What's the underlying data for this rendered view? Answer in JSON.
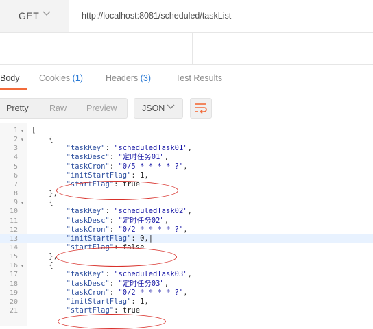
{
  "request": {
    "method": "GET",
    "url": "http://localhost:8081/scheduled/taskList"
  },
  "tabs": [
    {
      "label": "Body",
      "count": null,
      "active": true
    },
    {
      "label": "Cookies",
      "count": "(1)",
      "active": false
    },
    {
      "label": "Headers",
      "count": "(3)",
      "active": false
    },
    {
      "label": "Test Results",
      "count": null,
      "active": false
    }
  ],
  "toolbar": {
    "pretty": "Pretty",
    "raw": "Raw",
    "preview": "Preview",
    "format": "JSON"
  },
  "colors": {
    "accent": "#f26b3a",
    "count_blue": "#2a7ad5",
    "highlight_line": "#e8f2ff",
    "annotation_red": "#d8302a"
  },
  "highlighted_line": 13,
  "code_lines": [
    {
      "n": "1",
      "fold": true,
      "text": "["
    },
    {
      "n": "2",
      "fold": true,
      "text": "    {"
    },
    {
      "n": "3",
      "fold": false,
      "key": "taskKey",
      "value": "\"scheduledTask01\"",
      "comma": true
    },
    {
      "n": "4",
      "fold": false,
      "key": "taskDesc",
      "value": "\"定时任务01\"",
      "comma": true
    },
    {
      "n": "5",
      "fold": false,
      "key": "taskCron",
      "value": "\"0/5 * * * * ?\"",
      "comma": true
    },
    {
      "n": "6",
      "fold": false,
      "key": "initStartFlag",
      "value": "1",
      "comma": true
    },
    {
      "n": "7",
      "fold": false,
      "key": "startFlag",
      "value": "true",
      "comma": false
    },
    {
      "n": "8",
      "fold": false,
      "text": "    },"
    },
    {
      "n": "9",
      "fold": true,
      "text": "    {"
    },
    {
      "n": "10",
      "fold": false,
      "key": "taskKey",
      "value": "\"scheduledTask02\"",
      "comma": true
    },
    {
      "n": "11",
      "fold": false,
      "key": "taskDesc",
      "value": "\"定时任务02\"",
      "comma": true
    },
    {
      "n": "12",
      "fold": false,
      "key": "taskCron",
      "value": "\"0/2 * * * * ?\"",
      "comma": true
    },
    {
      "n": "13",
      "fold": false,
      "key": "initStartFlag",
      "value": "0",
      "comma": true
    },
    {
      "n": "14",
      "fold": false,
      "key": "startFlag",
      "value": "false",
      "comma": false
    },
    {
      "n": "15",
      "fold": false,
      "text": "    },"
    },
    {
      "n": "16",
      "fold": true,
      "text": "    {"
    },
    {
      "n": "17",
      "fold": false,
      "key": "taskKey",
      "value": "\"scheduledTask03\"",
      "comma": true
    },
    {
      "n": "18",
      "fold": false,
      "key": "taskDesc",
      "value": "\"定时任务03\"",
      "comma": true
    },
    {
      "n": "19",
      "fold": false,
      "key": "taskCron",
      "value": "\"0/2 * * * * ?\"",
      "comma": true
    },
    {
      "n": "20",
      "fold": false,
      "key": "initStartFlag",
      "value": "1",
      "comma": true
    },
    {
      "n": "21",
      "fold": false,
      "key": "startFlag",
      "value": "true",
      "comma": false
    }
  ]
}
